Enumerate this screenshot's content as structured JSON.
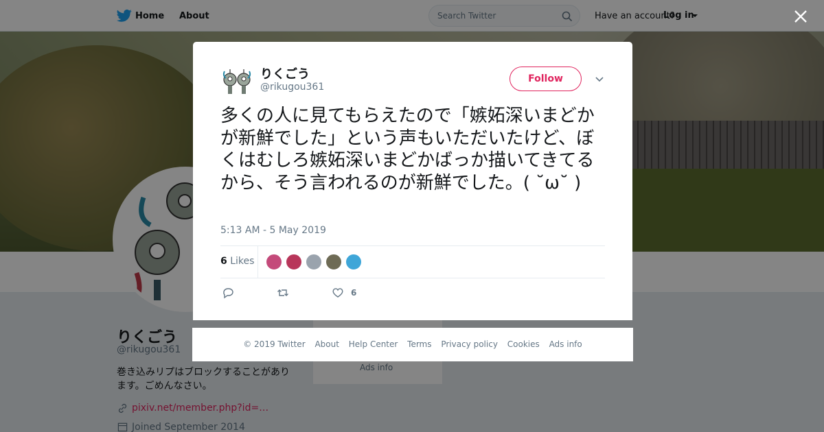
{
  "nav": {
    "home": "Home",
    "about": "About",
    "search_placeholder": "Search Twitter",
    "have_account": "Have an account?",
    "login": "Log in"
  },
  "profile": {
    "name": "りくごう",
    "handle": "@rikugou361",
    "bio": "巻き込みリプはブロックすることがあります。ごめんなさい。",
    "link": "pixiv.net/member.php?id=…",
    "joined": "Joined September 2014"
  },
  "sidebar": {
    "ads_info": "Ads info"
  },
  "tweet": {
    "name": "りくごう",
    "handle": "@rikugou361",
    "follow_label": "Follow",
    "text": "多くの人に見てもらえたので「嫉妬深いまどかが新鮮でした」という声もいただいたけど、ぼくはむしろ嫉妬深いまどかばっか描いてきてるから、そう言われるのが新鮮でした。( ˘ω˘ )",
    "timestamp": "5:13 AM - 5 May 2019",
    "likes_number": "6",
    "likes_label": "Likes",
    "like_action_count": "6",
    "likers": [
      "#c44a7a",
      "#b8365a",
      "#9aa3ad",
      "#6e6b55",
      "#3fa6d8"
    ]
  },
  "footer": {
    "links": [
      "© 2019 Twitter",
      "About",
      "Help Center",
      "Terms",
      "Privacy policy",
      "Cookies",
      "Ads info"
    ]
  },
  "colors": {
    "accent": "#e0245e",
    "twitter_blue": "#1da1f2"
  },
  "icons": [
    "twitter-bird-icon",
    "search-icon",
    "caret-down-icon",
    "close-icon",
    "chevron-down-icon",
    "reply-icon",
    "retweet-icon",
    "heart-icon",
    "link-icon",
    "calendar-icon"
  ]
}
